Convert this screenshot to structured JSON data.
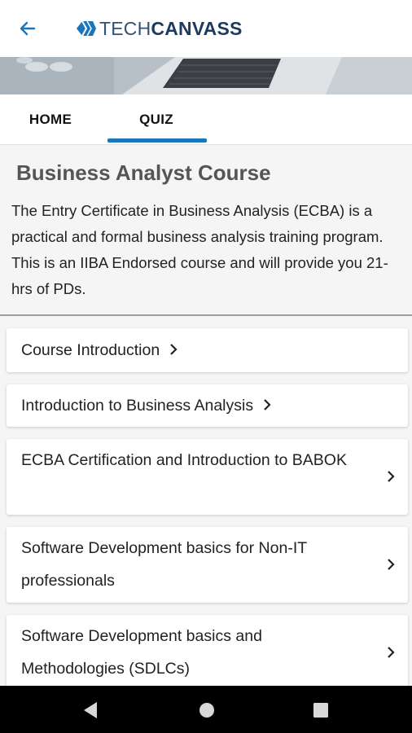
{
  "app": {
    "logo_tech": "TECH",
    "logo_canvass": "CANVASS",
    "back_icon": "arrow-left-icon",
    "accent_color": "#1b75bb"
  },
  "tabs": [
    {
      "label": "HOME",
      "active": false
    },
    {
      "label": "QUIZ",
      "active": true
    }
  ],
  "course": {
    "title": "Business Analyst Course",
    "description": "The Entry Certificate in Business Analysis (ECBA) is a practical and formal business analysis training program. This is an IIBA Endorsed course and will provide you 21-hrs of PDs."
  },
  "lessons": [
    {
      "title": "Course Introduction"
    },
    {
      "title": "Introduction to Business Analysis"
    },
    {
      "title": "ECBA Certification and Introduction to BABOK"
    },
    {
      "title": "Software Development basics for Non-IT professionals"
    },
    {
      "title": "Software Development basics and Methodologies (SDLCs)"
    }
  ],
  "nav": {
    "back_icon": "triangle-back-icon",
    "home_icon": "circle-home-icon",
    "recent_icon": "square-recents-icon"
  }
}
